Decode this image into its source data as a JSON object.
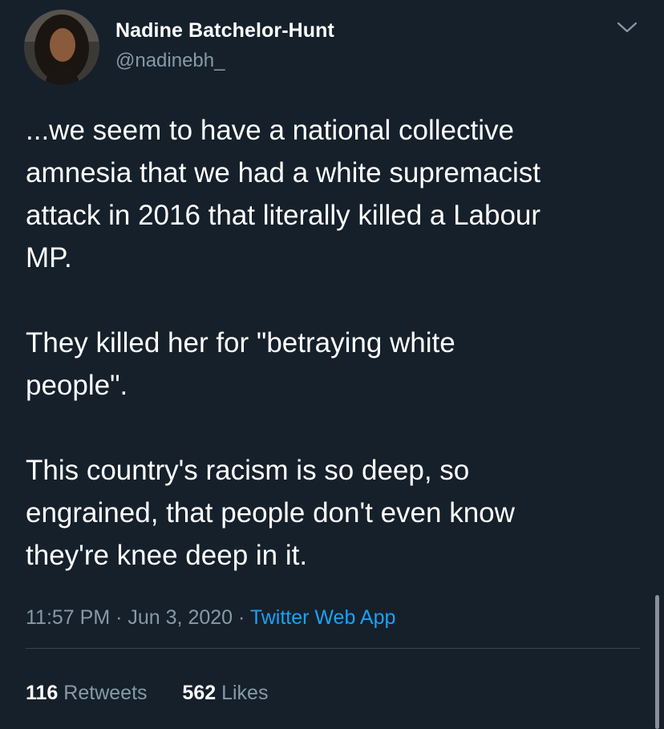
{
  "user": {
    "display_name": "Nadine Batchelor-Hunt",
    "handle": "@nadinebh_",
    "avatar_icon": "profile-photo"
  },
  "menu_icon": "chevron-down-icon",
  "tweet": {
    "paragraphs": [
      "...we seem to have a national collective\namnesia that we had a white supremacist\nattack in 2016 that literally killed a Labour\nMP.",
      "They killed her for \"betraying white\npeople\".",
      "This country's racism is so deep, so\nengrained, that people don't even know\nthey're knee deep in it."
    ]
  },
  "meta": {
    "time": "11:57 PM",
    "separator": "·",
    "date": "Jun 3, 2020",
    "source": "Twitter Web App"
  },
  "stats": {
    "retweets_count": "116",
    "retweets_label": "Retweets",
    "likes_count": "562",
    "likes_label": "Likes"
  },
  "colors": {
    "background": "#15202b",
    "primary_text": "#ffffff",
    "secondary_text": "#8899a6",
    "link": "#1da1f2",
    "divider": "#38444d"
  }
}
